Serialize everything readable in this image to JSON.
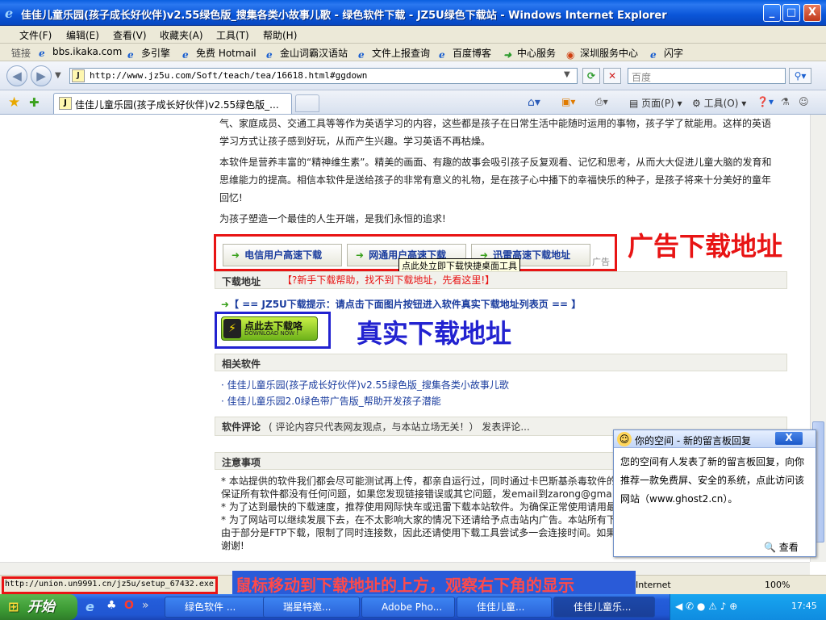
{
  "window": {
    "title": "佳佳儿童乐园(孩子成长好伙伴)v2.55绿色版_搜集各类小故事儿歌 - 绿色软件下载 - JZ5U绿色下载站 - Windows Internet Explorer",
    "buttons": [
      "_",
      "□",
      "X"
    ]
  },
  "menu": [
    "文件(F)",
    "编辑(E)",
    "查看(V)",
    "收藏夹(A)",
    "工具(T)",
    "帮助(H)"
  ],
  "links": {
    "label": "链接",
    "items": [
      "bbs.ikaka.com",
      "多引擎",
      "免费 Hotmail",
      "金山词霸汉语站",
      "文件上报查询",
      "百度博客",
      "中心服务",
      "深圳服务中心",
      "闪字"
    ]
  },
  "address": {
    "url": "http://www.jz5u.com/Soft/teach/tea/16618.html#ggdown",
    "search_placeholder": "百度"
  },
  "tab": {
    "title": "佳佳儿童乐园(孩子成长好伙伴)v2.55绿色版_..."
  },
  "toolbar": {
    "page": "页面(P)",
    "tools": "工具(O)"
  },
  "content": {
    "para1": "气、家庭成员、交通工具等等作为英语学习的内容，这些都是孩子在日常生活中能随时运用的事物，孩子学了就能用。这样的英语学习方式让孩子感到好玩，从而产生兴趣。学习英语不再枯燥。",
    "para2": "本软件是营养丰富的“精神维生素”。精美的画面、有趣的故事会吸引孩子反复观看、记忆和思考，从而大大促进儿童大脑的发育和思维能力的提高。相信本软件是送给孩子的非常有意义的礼物，是在孩子心中播下的幸福快乐的种子，是孩子将来十分美好的童年回忆!",
    "para3": "为孩子塑造一个最佳的人生开端，是我们永恒的追求!",
    "ad_buttons": [
      "电信用户高速下载",
      "网通用户高速下载",
      "迅雷高速下载地址"
    ],
    "ad_label": "广告",
    "tooltip": "点此处立即下载快捷桌面工具",
    "annotation_ad": "广告下载地址",
    "download_head": "下载地址",
    "download_help": "【?新手下载帮助，找不到下载地址，先看这里!】",
    "download_tip": "【 == JZ5U下载提示：请点击下面图片按钮进入软件真实下载地址列表页 == 】",
    "download_btn_cn": "点此去下载咯",
    "download_btn_en": "DOWNLOAD NOW !",
    "annotation_real": "真实下载地址",
    "related_head": "相关软件",
    "related": [
      "· 佳佳儿童乐园(孩子成长好伙伴)v2.55绿色版_搜集各类小故事儿歌",
      "· 佳佳儿童乐园2.0绿色带广告版_帮助开发孩子潜能"
    ],
    "comment_head": "软件评论",
    "comment_note": "( 评论内容只代表网友观点，与本站立场无关！） 发表评论...",
    "notice_head": "注意事项",
    "notice_lines": [
      "* 本站提供的软件我们都会尽可能测试再上传，都亲自运行过，同时通过卡巴斯基杀毒软件的",
      "保证所有软件都没有任何问题，如果您发现链接错误或其它问题，发email到zarong@gma",
      "* 为了达到最快的下载速度，推荐使用网际快车或迅雷下载本站软件。为确保正常使用请用最",
      "* 为了网站可以继续发展下去，在不太影响大家的情况下还请给予点击站内广告。本站所有下",
      "由于部分是FTP下载，限制了同时连接数，因此还请使用下载工具尝试多一会连接时间。如果",
      "谢谢!"
    ]
  },
  "popup": {
    "title": "你的空间 - 新的留言板回复",
    "close": "X",
    "message": "您的空间有人发表了新的留言板回复，向你推荐一款免费屏、安全的系统，点此访问该网站（www.ghost2.cn）。",
    "view": "查看"
  },
  "status": {
    "url": "http://union.un9991.cn/jz5u/setup_67432.exe",
    "annotation": "鼠标移动到下载地址的上方，观察右下角的显示",
    "zone": "Internet",
    "zoom": "100%"
  },
  "taskbar": {
    "start": "开始",
    "items": [
      "绿色软件 ...",
      "瑞星特邀...",
      "Adobe Pho...",
      "佳佳儿童...",
      "佳佳儿童乐..."
    ],
    "clock": "17:45"
  },
  "colors": {
    "annotation_red": "#e81414",
    "annotation_blue": "#2222d0",
    "title_blue": "#0a55d8"
  }
}
